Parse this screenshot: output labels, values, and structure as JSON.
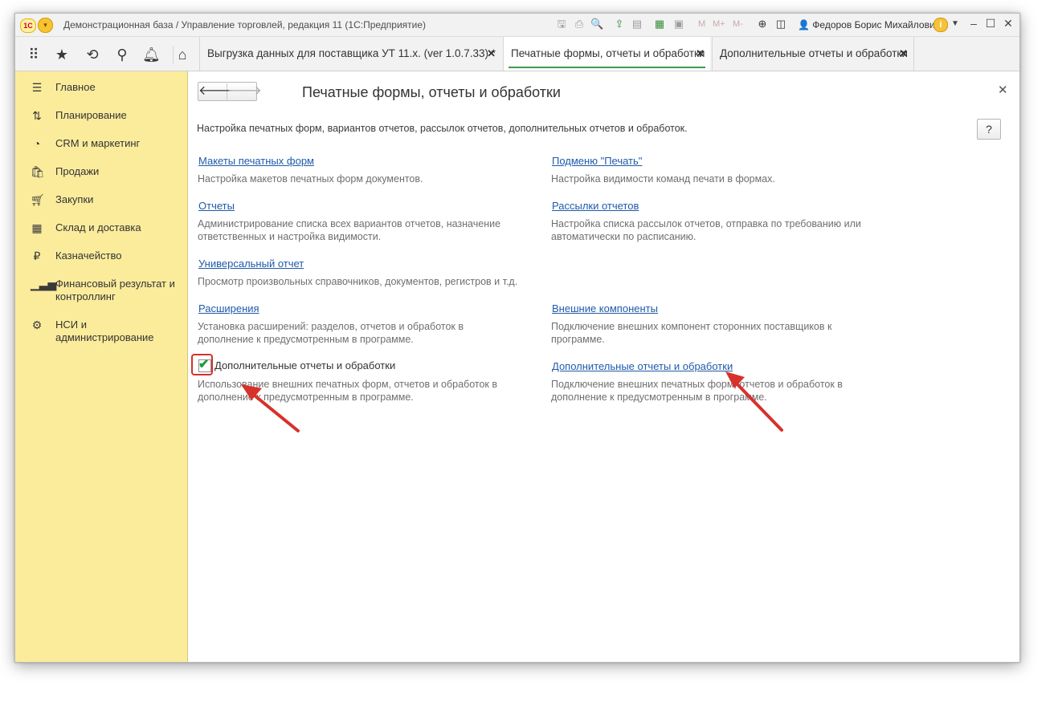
{
  "window": {
    "title": "Демонстрационная база / Управление торговлей, редакция 11  (1С:Предприятие)",
    "logo_text": "1С",
    "user": "Федоров Борис Михайлович",
    "toolbar_labels": [
      "M",
      "M+",
      "M-"
    ]
  },
  "top_panel": {
    "icons": [
      "apps-grid-icon",
      "favorites-star-icon",
      "history-icon",
      "search-icon",
      "notifications-bell-icon",
      "home-icon"
    ],
    "tabs": [
      {
        "label": "Выгрузка данных для поставщика УТ 11.х. (ver 1.0.7.33) *",
        "active": false
      },
      {
        "label": "Печатные формы, отчеты и обработки",
        "active": true
      },
      {
        "label": "Дополнительные отчеты и обработки",
        "active": false
      }
    ]
  },
  "sidebar": {
    "items": [
      {
        "label": "Главное",
        "icon": "menu-lines-icon"
      },
      {
        "label": "Планирование",
        "icon": "planning-icon"
      },
      {
        "label": "CRM и маркетинг",
        "icon": "pie-chart-icon"
      },
      {
        "label": "Продажи",
        "icon": "shopping-bag-icon"
      },
      {
        "label": "Закупки",
        "icon": "cart-icon"
      },
      {
        "label": "Склад и доставка",
        "icon": "warehouse-icon"
      },
      {
        "label": "Казначейство",
        "icon": "ruble-icon"
      },
      {
        "label": "Финансовый результат и контроллинг",
        "icon": "bar-chart-icon"
      },
      {
        "label": "НСИ и администрирование",
        "icon": "gear-icon"
      }
    ]
  },
  "page": {
    "title": "Печатные формы, отчеты и обработки",
    "description": "Настройка печатных форм, вариантов отчетов, рассылок отчетов, дополнительных отчетов и обработок.",
    "help_label": "?",
    "left": {
      "templates": {
        "link": "Макеты печатных форм",
        "desc": "Настройка макетов печатных форм документов."
      },
      "reports": {
        "link": "Отчеты",
        "desc": "Администрирование списка всех вариантов отчетов, назначение ответственных и настройка видимости."
      },
      "universal": {
        "link": "Универсальный отчет",
        "desc": "Просмотр произвольных справочников, документов, регистров и т.д."
      },
      "extensions": {
        "link": "Расширения",
        "desc": "Установка расширений: разделов, отчетов и обработок в дополнение к предусмотренным в программе."
      },
      "additional_checkbox": {
        "label": "Дополнительные отчеты и обработки",
        "checked": true,
        "desc": "Использование внешних печатных форм, отчетов и обработок в дополнение к предусмотренным в программе."
      }
    },
    "right": {
      "print_submenu": {
        "link": "Подменю \"Печать\"",
        "desc": "Настройка видимости команд печати в формах."
      },
      "mailings": {
        "link": "Рассылки отчетов",
        "desc": "Настройка списка рассылок отчетов, отправка по требованию или автоматически по расписанию."
      },
      "external_components": {
        "link": "Внешние компоненты",
        "desc": "Подключение внешних компонент сторонних поставщиков к программе."
      },
      "additional": {
        "link": "Дополнительные отчеты и обработки",
        "desc": "Подключение внешних печатных форм, отчетов и обработок в дополнение к предусмотренным в программе."
      }
    }
  },
  "colors": {
    "sidebar_bg": "#fbec9c",
    "link": "#1f5aa9",
    "active_tab_underline": "#3c9a4d",
    "annotation_red": "#d7312b"
  }
}
